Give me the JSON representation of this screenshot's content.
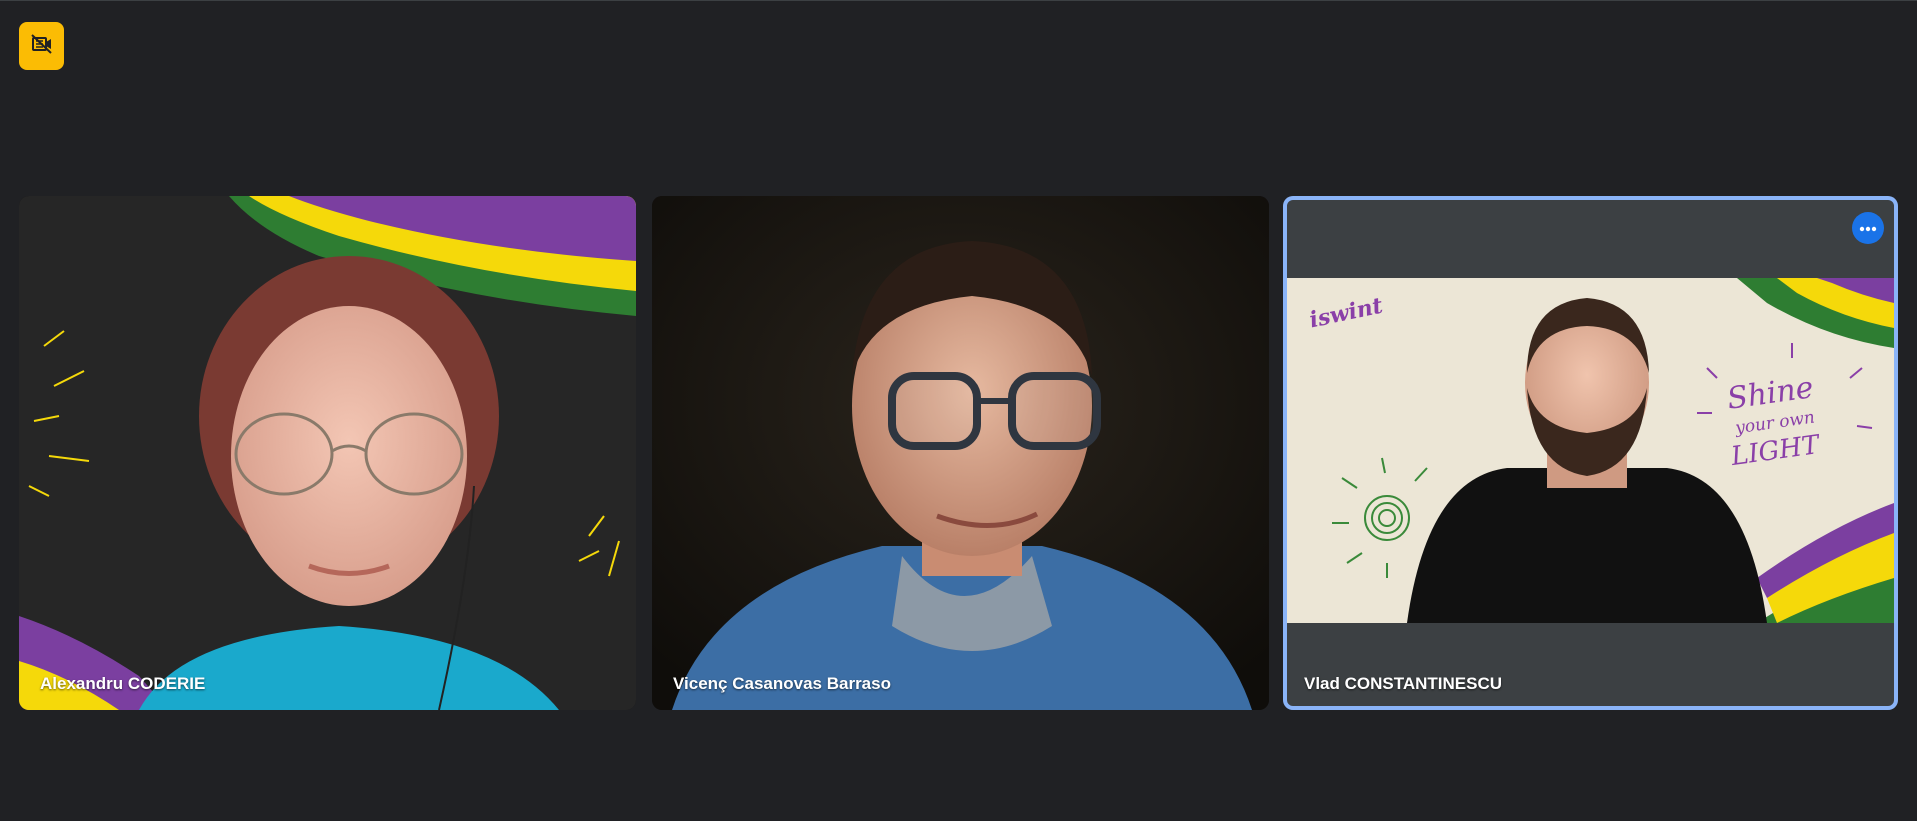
{
  "toolbar": {
    "recording_icon": "no-camera-badge-icon",
    "recording_color": "#fbbc04"
  },
  "participants": [
    {
      "name": "Alexandru CODERIE",
      "background": "chalkboard-ribbon",
      "highlighted": false
    },
    {
      "name": "Vicenç Casanovas Barraso",
      "background": "dark-room",
      "highlighted": false
    },
    {
      "name": "Vlad CONSTANTINESCU",
      "background": "shine-your-own-light",
      "highlighted": true,
      "more_options_icon": "more-horiz-icon",
      "background_text": {
        "brand": "iswint",
        "line1": "Shine",
        "line2": "your own",
        "line3": "LIGHT"
      }
    }
  ],
  "colors": {
    "background": "#202124",
    "highlight_border": "#8ab4f8",
    "accent_blue": "#1a73e8",
    "ribbon_purple": "#7b3fa0",
    "ribbon_yellow": "#f5d90a",
    "ribbon_green": "#2e7d32"
  }
}
